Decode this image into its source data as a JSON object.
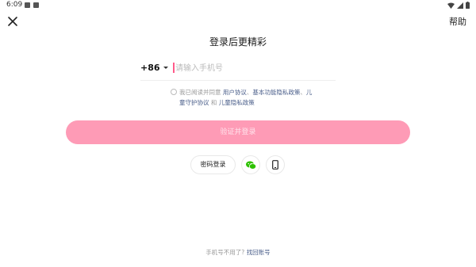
{
  "status_bar": {
    "time": "6:09",
    "left_icons": [
      "image-icon",
      "a-icon"
    ],
    "right_icons": [
      "wifi-icon",
      "signal-icon",
      "battery-icon"
    ]
  },
  "header": {
    "close_icon": "close-icon",
    "help_label": "帮助"
  },
  "title": "登录后更精彩",
  "phone": {
    "country_code": "+86",
    "placeholder": "请输入手机号",
    "value": ""
  },
  "agreement": {
    "prefix": "我已阅读并同意",
    "user_agreement": "用户协议",
    "sep1": "、",
    "privacy_policy": "基本功能隐私政策",
    "sep2": "、",
    "child_protection": "儿童守护协议",
    "and": "和",
    "child_privacy": "儿童隐私政策",
    "checked": false
  },
  "submit_label": "验证并登录",
  "alt_login": {
    "password_label": "密码登录",
    "wechat_icon": "wechat-icon",
    "phone_icon": "phone-device-icon"
  },
  "footer": {
    "question": "手机号不用了?",
    "recover": "找回账号"
  },
  "colors": {
    "accent": "#fe9bb6",
    "cursor": "#ff5a8a",
    "link": "#4a5e8a",
    "wechat": "#2dc100"
  }
}
